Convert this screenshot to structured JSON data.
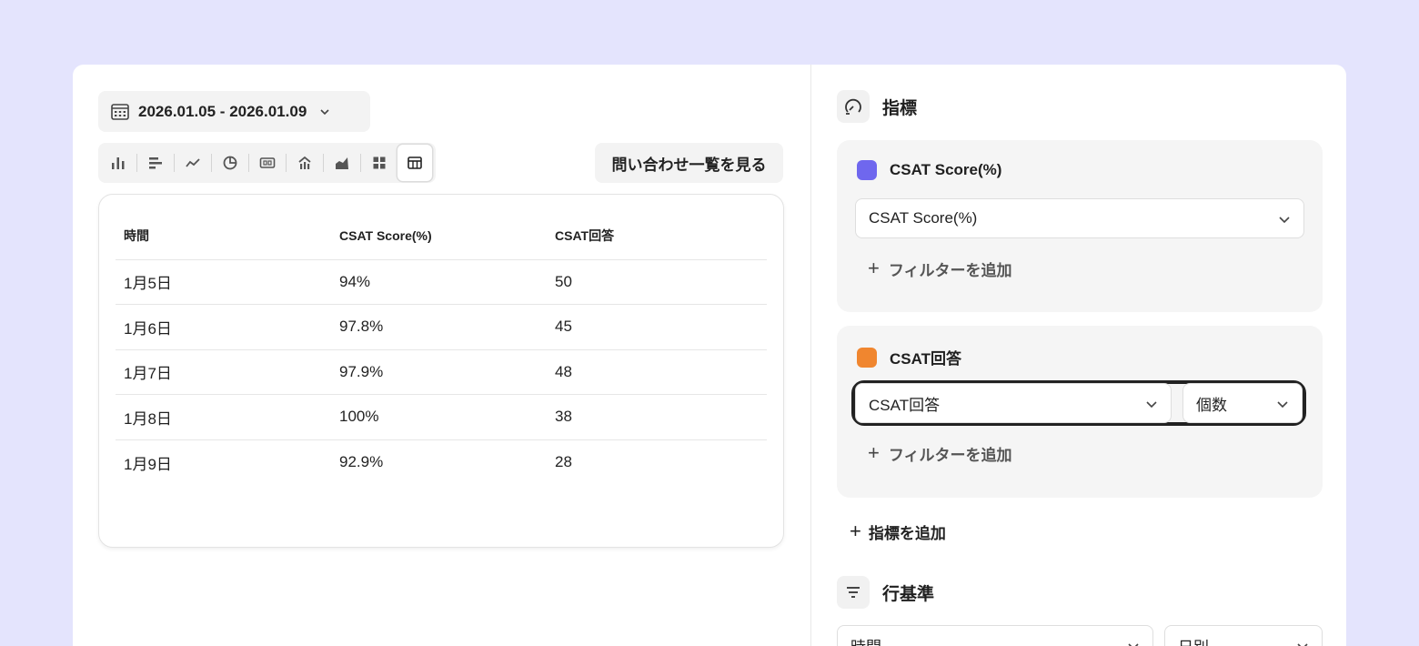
{
  "date_range": {
    "label": "2026.01.05 - 2026.01.09"
  },
  "chart_toolbar": {
    "types": [
      {
        "name": "bar-chart-icon"
      },
      {
        "name": "horizontal-bar-chart-icon"
      },
      {
        "name": "line-chart-icon"
      },
      {
        "name": "pie-chart-icon"
      },
      {
        "name": "number-card-icon"
      },
      {
        "name": "funnel-chart-icon"
      },
      {
        "name": "area-chart-icon"
      },
      {
        "name": "grid-icon"
      },
      {
        "name": "table-icon",
        "active": true
      }
    ]
  },
  "inquiry_button": {
    "label": "問い合わせ一覧を見る"
  },
  "table": {
    "headers": [
      "時間",
      "CSAT Score(%)",
      "CSAT回答"
    ],
    "rows": [
      [
        "1月5日",
        "94%",
        "50"
      ],
      [
        "1月6日",
        "97.8%",
        "45"
      ],
      [
        "1月7日",
        "97.9%",
        "48"
      ],
      [
        "1月8日",
        "100%",
        "38"
      ],
      [
        "1月9日",
        "92.9%",
        "28"
      ]
    ]
  },
  "metrics_section": {
    "title": "指標",
    "metrics": [
      {
        "title": "CSAT Score(%)",
        "color": "#6f67ee",
        "select_value": "CSAT Score(%)",
        "add_filter": "フィルターを追加"
      },
      {
        "title": "CSAT回答",
        "color": "#f0862f",
        "select_value": "CSAT回答",
        "aggregation": "個数",
        "add_filter": "フィルターを追加"
      }
    ],
    "add_metric": "指標を追加"
  },
  "rows_section": {
    "title": "行基準",
    "field_value": "時間",
    "granularity_value": "日別"
  }
}
